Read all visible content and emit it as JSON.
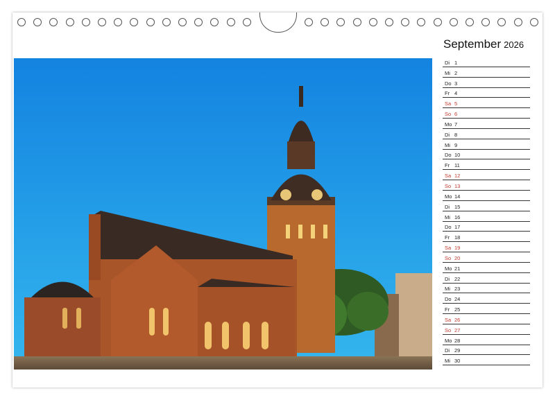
{
  "calendar": {
    "month": "September",
    "year": "2026"
  },
  "days": [
    {
      "weekday": "Di",
      "day": "1"
    },
    {
      "weekday": "Mi",
      "day": "2"
    },
    {
      "weekday": "Do",
      "day": "3"
    },
    {
      "weekday": "Fr",
      "day": "4"
    },
    {
      "weekday": "Sa",
      "day": "5",
      "weekend": true
    },
    {
      "weekday": "So",
      "day": "6",
      "weekend": true
    },
    {
      "weekday": "Mo",
      "day": "7"
    },
    {
      "weekday": "Di",
      "day": "8"
    },
    {
      "weekday": "Mi",
      "day": "9"
    },
    {
      "weekday": "Do",
      "day": "10"
    },
    {
      "weekday": "Fr",
      "day": "11"
    },
    {
      "weekday": "Sa",
      "day": "12",
      "weekend": true
    },
    {
      "weekday": "So",
      "day": "13",
      "weekend": true
    },
    {
      "weekday": "Mo",
      "day": "14"
    },
    {
      "weekday": "Di",
      "day": "15"
    },
    {
      "weekday": "Mi",
      "day": "16"
    },
    {
      "weekday": "Do",
      "day": "17"
    },
    {
      "weekday": "Fr",
      "day": "18"
    },
    {
      "weekday": "Sa",
      "day": "19",
      "weekend": true
    },
    {
      "weekday": "So",
      "day": "20",
      "weekend": true
    },
    {
      "weekday": "Mo",
      "day": "21"
    },
    {
      "weekday": "Di",
      "day": "22"
    },
    {
      "weekday": "Mi",
      "day": "23"
    },
    {
      "weekday": "Do",
      "day": "24"
    },
    {
      "weekday": "Fr",
      "day": "25"
    },
    {
      "weekday": "Sa",
      "day": "26",
      "weekend": true
    },
    {
      "weekday": "So",
      "day": "27",
      "weekend": true
    },
    {
      "weekday": "Mo",
      "day": "28"
    },
    {
      "weekday": "Di",
      "day": "29"
    },
    {
      "weekday": "Mi",
      "day": "30"
    }
  ],
  "colors": {
    "weekday_text": "#222222",
    "weekend_text": "#c0392b",
    "sky": "#1c8fe0",
    "brick": "#b0542a"
  }
}
